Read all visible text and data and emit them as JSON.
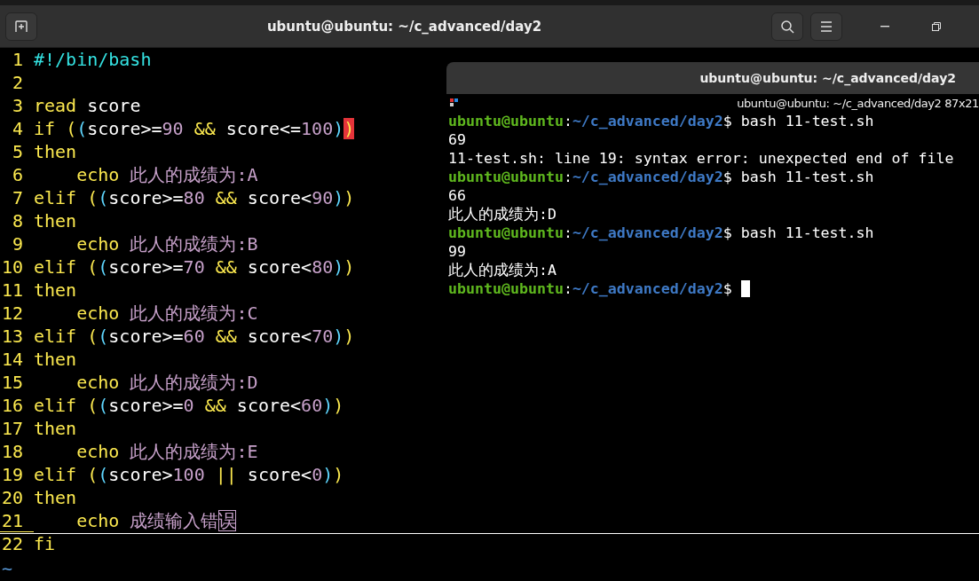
{
  "window": {
    "title": "ubuntu@ubuntu: ~/c_advanced/day2"
  },
  "editor": {
    "lines": [
      {
        "number": "1",
        "current": false,
        "tokens": [
          {
            "text": "#!/bin/bash",
            "kind": "shebang"
          }
        ]
      },
      {
        "number": "2",
        "current": false
      },
      {
        "number": "3",
        "current": false,
        "tokens": [
          {
            "text": "read ",
            "kind": "kw"
          },
          {
            "text": "score",
            "kind": "plain"
          }
        ]
      },
      {
        "number": "4",
        "current": false,
        "tokens": [
          {
            "text": "if ",
            "kind": "kw"
          },
          {
            "text": "(",
            "kind": "p1"
          },
          {
            "text": "(",
            "kind": "p2"
          },
          {
            "text": "score>=",
            "kind": "plain"
          },
          {
            "text": "90 ",
            "kind": "num"
          },
          {
            "text": "&&",
            "kind": "kw"
          },
          {
            "text": " score<=",
            "kind": "plain"
          },
          {
            "text": "100",
            "kind": "num"
          },
          {
            "text": ")",
            "kind": "p2"
          },
          {
            "text": ")",
            "kind": "match"
          }
        ]
      },
      {
        "number": "5",
        "current": false,
        "tokens": [
          {
            "text": "then",
            "kind": "kw"
          }
        ]
      },
      {
        "number": "6",
        "current": false,
        "tokens": [
          {
            "text": "    echo ",
            "kind": "kw"
          },
          {
            "text": "此人的成绩为:A",
            "kind": "str"
          }
        ]
      },
      {
        "number": "7",
        "current": false,
        "tokens": [
          {
            "text": "elif ",
            "kind": "kw"
          },
          {
            "text": "(",
            "kind": "p1"
          },
          {
            "text": "(",
            "kind": "p2"
          },
          {
            "text": "score>=",
            "kind": "plain"
          },
          {
            "text": "80 ",
            "kind": "num"
          },
          {
            "text": "&&",
            "kind": "kw"
          },
          {
            "text": " score<",
            "kind": "plain"
          },
          {
            "text": "90",
            "kind": "num"
          },
          {
            "text": ")",
            "kind": "p2"
          },
          {
            "text": ")",
            "kind": "p1"
          }
        ]
      },
      {
        "number": "8",
        "current": false,
        "tokens": [
          {
            "text": "then",
            "kind": "kw"
          }
        ]
      },
      {
        "number": "9",
        "current": false,
        "tokens": [
          {
            "text": "    echo ",
            "kind": "kw"
          },
          {
            "text": "此人的成绩为:B",
            "kind": "str"
          }
        ]
      },
      {
        "number": "10",
        "current": false,
        "tokens": [
          {
            "text": "elif ",
            "kind": "kw"
          },
          {
            "text": "(",
            "kind": "p1"
          },
          {
            "text": "(",
            "kind": "p2"
          },
          {
            "text": "score>=",
            "kind": "plain"
          },
          {
            "text": "70 ",
            "kind": "num"
          },
          {
            "text": "&&",
            "kind": "kw"
          },
          {
            "text": " score<",
            "kind": "plain"
          },
          {
            "text": "80",
            "kind": "num"
          },
          {
            "text": ")",
            "kind": "p2"
          },
          {
            "text": ")",
            "kind": "p1"
          }
        ]
      },
      {
        "number": "11",
        "current": false,
        "tokens": [
          {
            "text": "then",
            "kind": "kw"
          }
        ]
      },
      {
        "number": "12",
        "current": false,
        "tokens": [
          {
            "text": "    echo ",
            "kind": "kw"
          },
          {
            "text": "此人的成绩为:C",
            "kind": "str"
          }
        ]
      },
      {
        "number": "13",
        "current": false,
        "tokens": [
          {
            "text": "elif ",
            "kind": "kw"
          },
          {
            "text": "(",
            "kind": "p1"
          },
          {
            "text": "(",
            "kind": "p2"
          },
          {
            "text": "score>=",
            "kind": "plain"
          },
          {
            "text": "60 ",
            "kind": "num"
          },
          {
            "text": "&&",
            "kind": "kw"
          },
          {
            "text": " score<",
            "kind": "plain"
          },
          {
            "text": "70",
            "kind": "num"
          },
          {
            "text": ")",
            "kind": "p2"
          },
          {
            "text": ")",
            "kind": "p1"
          }
        ]
      },
      {
        "number": "14",
        "current": false,
        "tokens": [
          {
            "text": "then",
            "kind": "kw"
          }
        ]
      },
      {
        "number": "15",
        "current": false,
        "tokens": [
          {
            "text": "    echo ",
            "kind": "kw"
          },
          {
            "text": "此人的成绩为:D",
            "kind": "str"
          }
        ]
      },
      {
        "number": "16",
        "current": false,
        "tokens": [
          {
            "text": "elif ",
            "kind": "kw"
          },
          {
            "text": "(",
            "kind": "p1"
          },
          {
            "text": "(",
            "kind": "p2"
          },
          {
            "text": "score>=",
            "kind": "plain"
          },
          {
            "text": "0 ",
            "kind": "num"
          },
          {
            "text": "&&",
            "kind": "kw"
          },
          {
            "text": " score<",
            "kind": "plain"
          },
          {
            "text": "60",
            "kind": "num"
          },
          {
            "text": ")",
            "kind": "p2"
          },
          {
            "text": ")",
            "kind": "p1"
          }
        ]
      },
      {
        "number": "17",
        "current": false,
        "tokens": [
          {
            "text": "then",
            "kind": "kw"
          }
        ]
      },
      {
        "number": "18",
        "current": false,
        "tokens": [
          {
            "text": "    echo ",
            "kind": "kw"
          },
          {
            "text": "此人的成绩为:E",
            "kind": "str"
          }
        ]
      },
      {
        "number": "19",
        "current": false,
        "tokens": [
          {
            "text": "elif ",
            "kind": "kw"
          },
          {
            "text": "(",
            "kind": "p1"
          },
          {
            "text": "(",
            "kind": "p2"
          },
          {
            "text": "score>",
            "kind": "plain"
          },
          {
            "text": "100 ",
            "kind": "num"
          },
          {
            "text": "||",
            "kind": "kw"
          },
          {
            "text": " score<",
            "kind": "plain"
          },
          {
            "text": "0",
            "kind": "num"
          },
          {
            "text": ")",
            "kind": "p2"
          },
          {
            "text": ")",
            "kind": "p1"
          }
        ]
      },
      {
        "number": "20",
        "current": false,
        "tokens": [
          {
            "text": "then",
            "kind": "kw"
          }
        ]
      },
      {
        "number": "21",
        "current": true,
        "tokens": [
          {
            "text": "    echo ",
            "kind": "kw"
          },
          {
            "text": "成绩输入错",
            "kind": "str"
          },
          {
            "text": "误",
            "kind": "cursor"
          }
        ]
      },
      {
        "number": "22",
        "current": false,
        "tokens": [
          {
            "text": "fi",
            "kind": "kw"
          }
        ]
      }
    ],
    "filler": [
      "~"
    ]
  },
  "terminal": {
    "title": "ubuntu@ubuntu: ~/c_advanced/day2",
    "size_label": "ubuntu@ubuntu: ~/c_advanced/day2 87x21",
    "lines": [
      {
        "kind": "prompt",
        "cursor": false,
        "user": "ubuntu@ubuntu",
        "sep": ":",
        "path": "~/c_advanced/day2",
        "sign": "$",
        "command": "bash 11-test.sh"
      },
      {
        "kind": "out",
        "cursor": false,
        "text": "69"
      },
      {
        "kind": "out",
        "cursor": false,
        "text": "11-test.sh: line 19: syntax error: unexpected end of file"
      },
      {
        "kind": "prompt",
        "cursor": false,
        "user": "ubuntu@ubuntu",
        "sep": ":",
        "path": "~/c_advanced/day2",
        "sign": "$",
        "command": "bash 11-test.sh"
      },
      {
        "kind": "out",
        "cursor": false,
        "text": "66"
      },
      {
        "kind": "out",
        "cursor": false,
        "text": "此人的成绩为:D"
      },
      {
        "kind": "prompt",
        "cursor": false,
        "user": "ubuntu@ubuntu",
        "sep": ":",
        "path": "~/c_advanced/day2",
        "sign": "$",
        "command": "bash 11-test.sh"
      },
      {
        "kind": "out",
        "cursor": false,
        "text": "99"
      },
      {
        "kind": "out",
        "cursor": false,
        "text": "此人的成绩为:A"
      },
      {
        "kind": "prompt",
        "cursor": true,
        "user": "ubuntu@ubuntu",
        "sep": ":",
        "path": "~/c_advanced/day2",
        "sign": "$"
      }
    ]
  }
}
